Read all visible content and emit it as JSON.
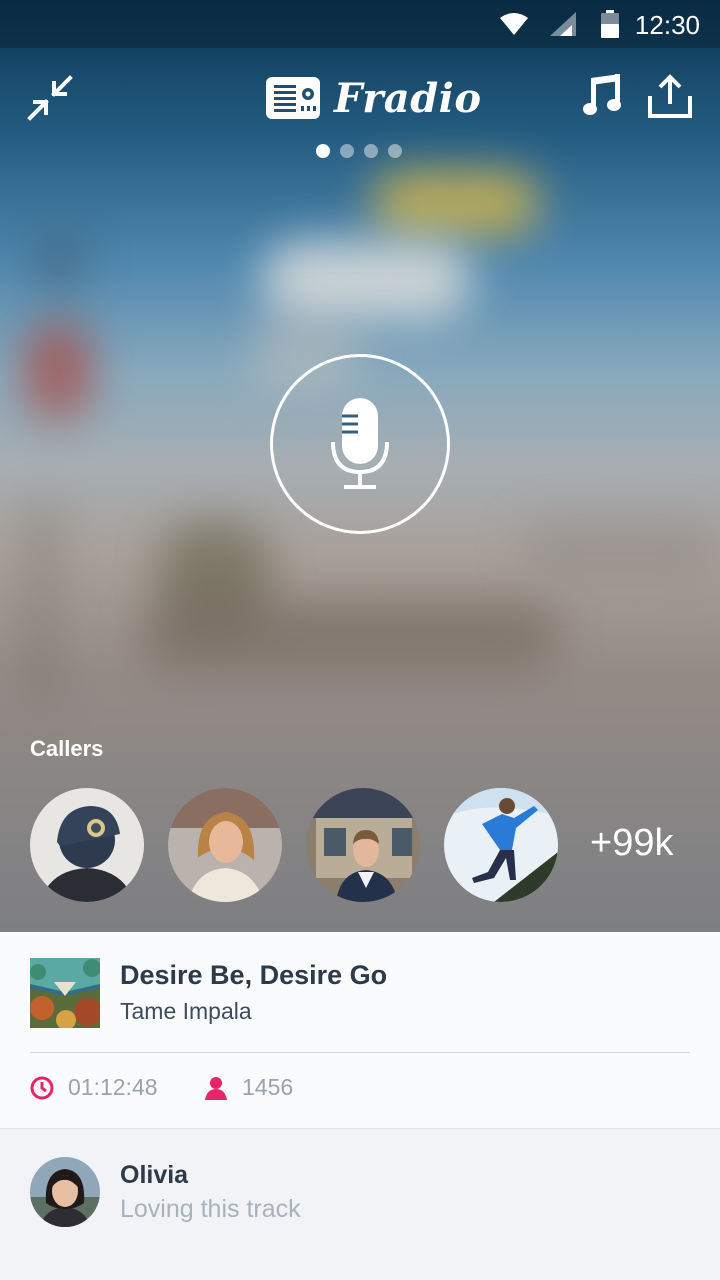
{
  "status_bar": {
    "time": "12:30",
    "icons": [
      "wifi-icon",
      "signal-icon",
      "battery-icon"
    ]
  },
  "header": {
    "app_name": "Fradio",
    "left_icon": "collapse-icon",
    "right_icons": [
      "music-note-icon",
      "share-icon"
    ],
    "page_dots": {
      "count": 4,
      "active_index": 0
    }
  },
  "microphone": {
    "icon": "microphone-icon"
  },
  "callers": {
    "label": "Callers",
    "avatars": [
      "caller-1",
      "caller-2",
      "caller-3",
      "caller-4"
    ],
    "more_count": "+99k"
  },
  "now_playing": {
    "title": "Desire Be, Desire Go",
    "artist": "Tame Impala",
    "duration": "01:12:48",
    "listeners": "1456"
  },
  "comment": {
    "name": "Olivia",
    "text": "Loving this track"
  },
  "colors": {
    "accent": "#e6246a",
    "text_dark": "#2d3a4a",
    "text_muted": "#9aa3ad"
  }
}
